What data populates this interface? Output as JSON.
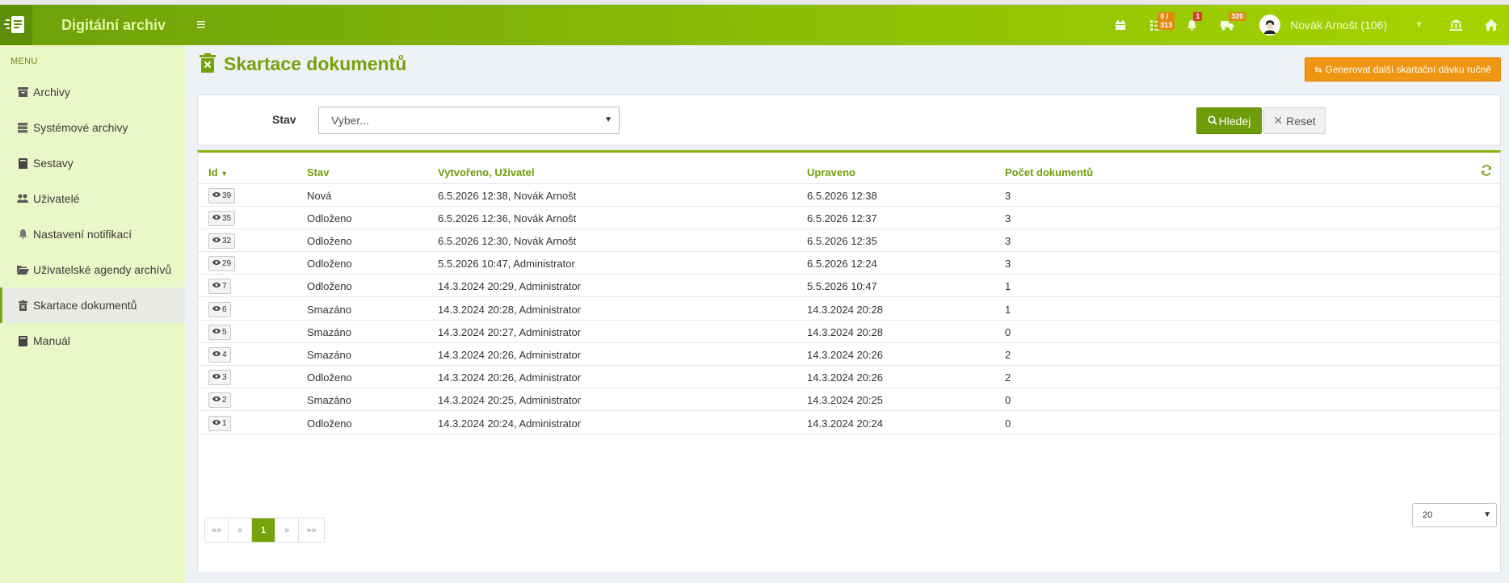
{
  "app": {
    "name": "Digitální archiv"
  },
  "header": {
    "badges": {
      "tasks": "0 / 313",
      "notifications": "1",
      "transport": "320"
    },
    "user": "Novák Arnošt (106)"
  },
  "sidebar": {
    "menu_title": "MENU",
    "items": [
      {
        "label": "Archivy",
        "icon": "archive-icon"
      },
      {
        "label": "Systémové archivy",
        "icon": "database-icon"
      },
      {
        "label": "Sestavy",
        "icon": "book-icon"
      },
      {
        "label": "Uživatelé",
        "icon": "users-icon"
      },
      {
        "label": "Nastavení notifikací",
        "icon": "bell-icon"
      },
      {
        "label": "Uživatelské agendy archívů",
        "icon": "folder-open-icon"
      },
      {
        "label": "Skartace dokumentů",
        "icon": "trash-icon",
        "active": true
      },
      {
        "label": "Manuál",
        "icon": "book-icon"
      }
    ]
  },
  "page": {
    "title": "Skartace dokumentů",
    "generate_button": "Generovat další skartační dávku ručně"
  },
  "filter": {
    "label": "Stav",
    "select_value": "Vyber...",
    "search_button": "Hledej",
    "reset_button": "Reset"
  },
  "table": {
    "headers": {
      "id": "Id",
      "stav": "Stav",
      "vytvoreno": "Vytvořeno",
      "uzivatel": "Uživatel",
      "upraveno": "Upraveno",
      "pocet": "Počet dokumentů"
    },
    "rows": [
      {
        "id": "39",
        "stav": "Nová",
        "vytvoreno": "6.5.2026 12:38, Novák Arnošt",
        "upraveno": "6.5.2026 12:38",
        "pocet": "3"
      },
      {
        "id": "35",
        "stav": "Odloženo",
        "vytvoreno": "6.5.2026 12:36, Novák Arnošt",
        "upraveno": "6.5.2026 12:37",
        "pocet": "3"
      },
      {
        "id": "32",
        "stav": "Odloženo",
        "vytvoreno": "6.5.2026 12:30, Novák Arnošt",
        "upraveno": "6.5.2026 12:35",
        "pocet": "3"
      },
      {
        "id": "29",
        "stav": "Odloženo",
        "vytvoreno": "5.5.2026 10:47, Administrator",
        "upraveno": "6.5.2026 12:24",
        "pocet": "3"
      },
      {
        "id": "7",
        "stav": "Odloženo",
        "vytvoreno": "14.3.2024 20:29, Administrator",
        "upraveno": "5.5.2026 10:47",
        "pocet": "1"
      },
      {
        "id": "6",
        "stav": "Smazáno",
        "vytvoreno": "14.3.2024 20:28, Administrator",
        "upraveno": "14.3.2024 20:28",
        "pocet": "1"
      },
      {
        "id": "5",
        "stav": "Smazáno",
        "vytvoreno": "14.3.2024 20:27, Administrator",
        "upraveno": "14.3.2024 20:28",
        "pocet": "0"
      },
      {
        "id": "4",
        "stav": "Smazáno",
        "vytvoreno": "14.3.2024 20:26, Administrator",
        "upraveno": "14.3.2024 20:26",
        "pocet": "2"
      },
      {
        "id": "3",
        "stav": "Odloženo",
        "vytvoreno": "14.3.2024 20:26, Administrator",
        "upraveno": "14.3.2024 20:26",
        "pocet": "2"
      },
      {
        "id": "2",
        "stav": "Smazáno",
        "vytvoreno": "14.3.2024 20:25, Administrator",
        "upraveno": "14.3.2024 20:25",
        "pocet": "0"
      },
      {
        "id": "1",
        "stav": "Odloženo",
        "vytvoreno": "14.3.2024 20:24, Administrator",
        "upraveno": "14.3.2024 20:24",
        "pocet": "0"
      }
    ]
  },
  "pagination": {
    "first": "««",
    "prev": "«",
    "current": "1",
    "next": "»",
    "last": "»»",
    "page_size": "20"
  },
  "colors": {
    "brand": "#76a30c",
    "accent": "#ef9512",
    "sidebar_bg": "#ecf7c8"
  }
}
